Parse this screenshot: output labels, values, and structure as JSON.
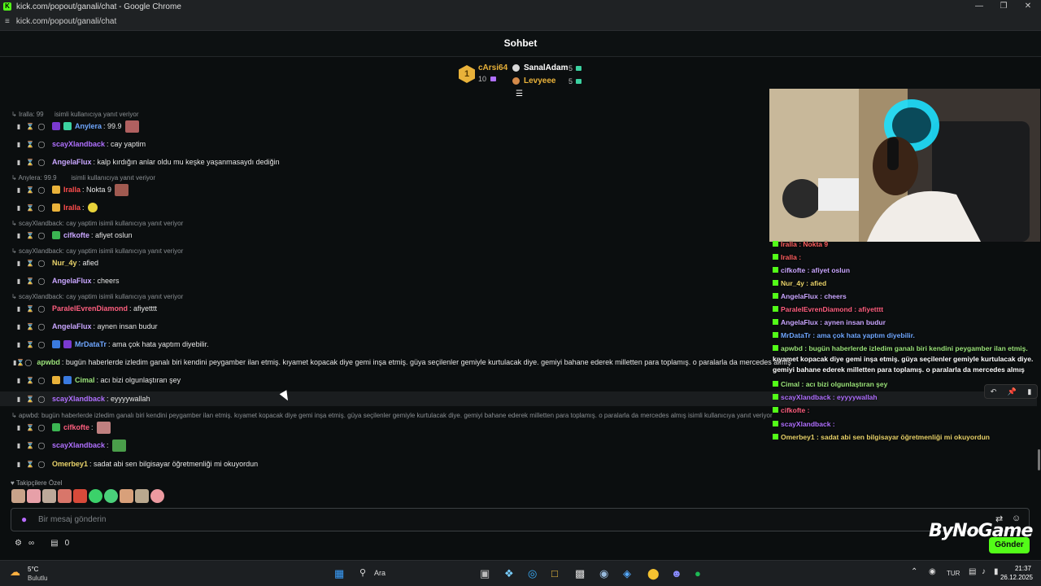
{
  "window": {
    "title": "kick.com/popout/ganali/chat - Google Chrome",
    "url": "kick.com/popout/ganali/chat"
  },
  "header": {
    "title": "Sohbet"
  },
  "leaderboard": {
    "first": {
      "rank": "1",
      "name": "cArsi64",
      "count": "10"
    },
    "second": {
      "name": "SanalAdam",
      "count": "5"
    },
    "third": {
      "name": "Levyeee",
      "count": "5"
    }
  },
  "chat": {
    "reply1": "Iralla: 99      isimli kullanıcıya yanıt veriyor",
    "m1": {
      "user": "Anylera",
      "text": ": 99.9"
    },
    "m2": {
      "user": "scayXlandback",
      "text": ": cay yaptim"
    },
    "m3": {
      "user": "AngelaFlux",
      "text": ": kalp kırdığın anlar oldu mu keşke yaşanmasaydı dediğin"
    },
    "reply2": "Anylera: 99.9        isimli kullanıcıya yanıt veriyor",
    "m4": {
      "user": "Iralla",
      "text": ": Nokta 9"
    },
    "m5": {
      "user": "Iralla",
      "text": ":"
    },
    "reply3": "scayXlandback: cay yaptim isimli kullanıcıya yanıt veriyor",
    "m6": {
      "user": "cifkofte",
      "text": ": afiyet oslun"
    },
    "reply4": "scayXlandback: cay yaptim isimli kullanıcıya yanıt veriyor",
    "m7": {
      "user": "Nur_4y",
      "text": ": afied"
    },
    "m8": {
      "user": "AngelaFlux",
      "text": ": cheers"
    },
    "reply5": "scayXlandback: cay yaptim isimli kullanıcıya yanıt veriyor",
    "m9": {
      "user": "ParalelEvrenDiamond",
      "text": ": afiyetttt"
    },
    "m10": {
      "user": "AngelaFlux",
      "text": ": aynen insan budur"
    },
    "m11": {
      "user": "MrDataTr",
      "text": ": ama çok hata yaptım diyebilir."
    },
    "m12": {
      "user": "apwbd",
      "text": ": bugün haberlerde izledim ganalı biri kendini peygamber ilan etmiş. kıyamet kopacak diye gemi inşa etmiş. güya seçilenler gemiyle kurtulacak diye. gemiyi bahane ederek milletten para toplamış. o paralarla da mercedes almış"
    },
    "m13": {
      "user": "Cimal",
      "text": ": acı bizi olgunlaştıran şey"
    },
    "m14": {
      "user": "scayXlandback",
      "text": ": eyyyywallah"
    },
    "reply6": "apwbd: bugün haberlerde izledim ganalı biri kendini peygamber ilan etmiş. kıyamet kopacak diye gemi inşa etmiş. güya seçilenler gemiyle kurtulacak diye. gemiyi bahane ederek milletten para toplamış. o paralarla da mercedes almış isimli kullanıcıya yanıt veriyor",
    "m15": {
      "user": "cifkofte",
      "text": ":"
    },
    "m16": {
      "user": "scayXlandback",
      "text": ":"
    },
    "m17": {
      "user": "Omerbey1",
      "text": ": sadat abi sen bilgisayar öğretmenliği mi okuyordun"
    }
  },
  "composer": {
    "subs_only": "Takipçilere Özel",
    "placeholder": "Bir mesaj gönderin",
    "send": "Gönder",
    "points": "0"
  },
  "overlay": {
    "o1": "Iralla : Nokta 9",
    "o2": "Iralla :",
    "o3": "cifkofte : afiyet oslun",
    "o4": "Nur_4y : afied",
    "o5": "AngelaFlux : cheers",
    "o6": "ParalelEvrenDiamond : afiyetttt",
    "o7": "AngelaFlux : aynen insan budur",
    "o8": "MrDataTr : ama çok hata yaptım diyebilir.",
    "o9a": "apwbd : bugün haberlerde izledim ganalı biri kendini peygamber ilan etmiş.",
    "o9b": "kıyamet kopacak diye gemi inşa etmiş. güya seçilenler gemiyle kurtulacak diye.",
    "o9c": "gemiyi bahane ederek milletten para toplamış. o paralarla da mercedes almış",
    "o10": "Cimal : acı bizi olgunlaştıran şey",
    "o11": "scayXlandback : eyyyywallah",
    "o12": "cifkofte :",
    "o13": "scayXlandback :",
    "o14": "Omerbey1 : sadat abi sen bilgisayar öğretmenliği mi okuyordun"
  },
  "brand": "ByNoGame",
  "taskbar": {
    "temp": "5°C",
    "weather": "Bulutlu",
    "search": "Ara",
    "lang": "TUR",
    "time": "21:37",
    "date": "26.12.2025"
  },
  "colors": {
    "accent": "#53fc18",
    "bg": "#0b0e0f"
  }
}
